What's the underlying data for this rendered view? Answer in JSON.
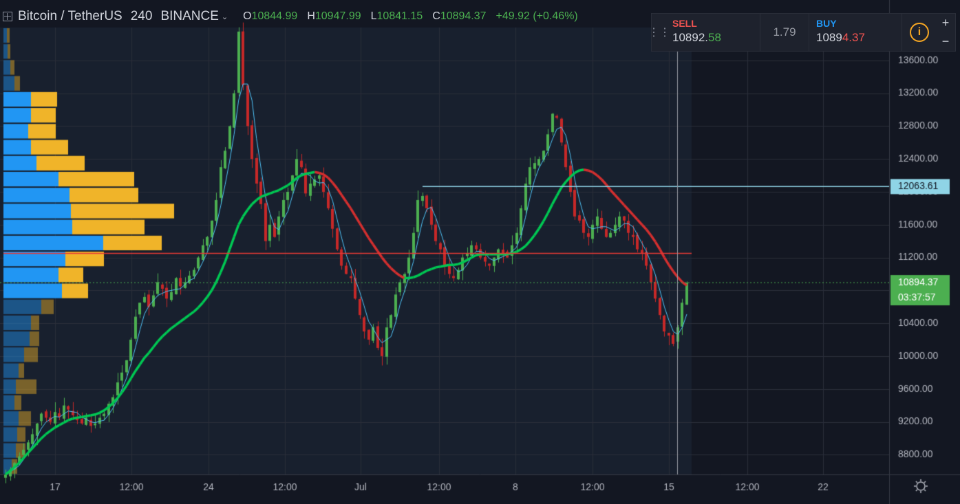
{
  "header": {
    "symbol": "Bitcoin / TetherUS",
    "interval": "240",
    "exchange": "BINANCE",
    "open_label": "O",
    "open": "10844.99",
    "high_label": "H",
    "high": "10947.99",
    "low_label": "L",
    "low": "10841.15",
    "close_label": "C",
    "close": "10894.37",
    "change": "+49.92 (+0.46%)"
  },
  "trade_panel": {
    "sell_label": "SELL",
    "sell_price_main": "10892.",
    "sell_price_tail": "58",
    "spread": "1.79",
    "buy_label": "BUY",
    "buy_price_main": "1089",
    "buy_price_tail": "4.37",
    "info_glyph": "i",
    "zoom_in": "+",
    "zoom_out": "−"
  },
  "colors": {
    "background": "#131722",
    "up_candle": "#4caf50",
    "down_candle": "#c62828",
    "ma_fast": "#00c853",
    "ma_slow": "#d32f2f",
    "short_ma": "#4fc3f7",
    "volume_profile_buy": "#2196f3",
    "volume_profile_sell": "#f0b429",
    "price_label_bg": "#4caf50",
    "horizontal_line_light": "#8fd4e6",
    "horizontal_line_red": "#e53935"
  },
  "chart_data": {
    "type": "candlestick",
    "y_axis_ticks": [
      "13600.00",
      "13200.00",
      "12800.00",
      "12400.00",
      "12000.00",
      "11600.00",
      "11200.00",
      "10800.00",
      "10400.00",
      "10000.00",
      "9600.00",
      "9200.00",
      "8800.00"
    ],
    "ylim": [
      8560,
      14000
    ],
    "x_axis_ticks": [
      "17",
      "12:00",
      "24",
      "12:00",
      "Jul",
      "12:00",
      "8",
      "12:00",
      "15",
      "12:00",
      "22"
    ],
    "current_price": "10894.37",
    "countdown": "03:37:57",
    "horizontal_level_label": "12063.61",
    "horizontal_level": 12063.61,
    "red_level": 11250,
    "close_series": [
      8560,
      8620,
      8700,
      8780,
      8860,
      8950,
      9050,
      9180,
      9300,
      9250,
      9200,
      9320,
      9260,
      9400,
      9350,
      9280,
      9220,
      9180,
      9250,
      9150,
      9180,
      9250,
      9300,
      9420,
      9500,
      9680,
      9800,
      9950,
      10200,
      10480,
      10650,
      10720,
      10600,
      10740,
      10900,
      10820,
      10700,
      10780,
      10950,
      10850,
      10900,
      10980,
      11050,
      11200,
      11350,
      11450,
      11650,
      11900,
      12300,
      12500,
      12800,
      13200,
      13950,
      13300,
      12800,
      12400,
      12100,
      11850,
      11400,
      11600,
      11450,
      11700,
      11900,
      12000,
      12200,
      12400,
      12300,
      11980,
      12100,
      12150,
      12200,
      12000,
      11800,
      11550,
      11300,
      11100,
      11000,
      10950,
      10700,
      10500,
      10300,
      10200,
      10350,
      10100,
      10000,
      10350,
      10500,
      10750,
      10900,
      11000,
      11200,
      11500,
      11900,
      11950,
      11800,
      11600,
      11400,
      11300,
      11100,
      11000,
      10950,
      11050,
      11200,
      11250,
      11350,
      11300,
      11200,
      11150,
      11100,
      11200,
      11300,
      11250,
      11200,
      11350,
      11500,
      11800,
      12100,
      12300,
      12350,
      12400,
      12500,
      12700,
      12950,
      12900,
      12600,
      12300,
      12000,
      11700,
      11650,
      11500,
      11450,
      11600,
      11700,
      11550,
      11450,
      11500,
      11600,
      11700,
      11650,
      11500,
      11450,
      11300,
      11250,
      11100,
      10900,
      10700,
      10500,
      10300,
      10250,
      10150,
      10350,
      10650,
      10894
    ],
    "ma_fast": [
      8560,
      8600,
      8650,
      8700,
      8760,
      8820,
      8880,
      8940,
      9000,
      9050,
      9090,
      9130,
      9160,
      9190,
      9220,
      9240,
      9250,
      9260,
      9270,
      9280,
      9290,
      9310,
      9340,
      9380,
      9430,
      9490,
      9560,
      9640,
      9730,
      9820,
      9900,
      9980,
      10040,
      10110,
      10180,
      10240,
      10290,
      10340,
      10380,
      10420,
      10460,
      10500,
      10540,
      10590,
      10650,
      10720,
      10800,
      10900,
      11020,
      11150,
      11300,
      11450,
      11600,
      11700,
      11780,
      11850,
      11900,
      11940,
      11960,
      11980,
      12000,
      12020,
      12050,
      12080,
      12120,
      12170,
      12200,
      12220,
      12230,
      12240,
      12230,
      12210,
      12170,
      12110,
      12040,
      11960,
      11880,
      11800,
      11710,
      11620,
      11530,
      11440,
      11360,
      11280,
      11200,
      11130,
      11070,
      11020,
      10980,
      10950,
      10950,
      10960,
      10980,
      11010,
      11040,
      11060,
      11080,
      11090,
      11100,
      11110,
      11110,
      11120,
      11140,
      11170,
      11200,
      11230,
      11240,
      11240,
      11240,
      11240,
      11240,
      11240,
      11240,
      11250,
      11270,
      11300,
      11340,
      11400,
      11470,
      11550,
      11640,
      11740,
      11850,
      11950,
      12050,
      12120,
      12180,
      12230,
      12260,
      12270,
      12260,
      12240,
      12200,
      12150,
      12090,
      12020,
      11960,
      11900,
      11840,
      11780,
      11720,
      11660,
      11600,
      11540,
      11470,
      11390,
      11300,
      11200,
      11110,
      11030,
      10960,
      10900,
      10860
    ],
    "ma_slow_line_note": ""
  },
  "volume_profile": {
    "buy_widths": [
      5,
      6,
      10,
      16,
      40,
      40,
      36,
      40,
      48,
      80,
      96,
      98,
      100,
      145,
      90,
      80,
      85,
      55,
      40,
      38,
      30,
      22,
      18,
      16,
      22,
      20,
      18,
      12
    ],
    "sell_widths": [
      4,
      4,
      6,
      8,
      38,
      36,
      40,
      54,
      70,
      110,
      100,
      150,
      105,
      85,
      56,
      36,
      38,
      18,
      12,
      14,
      20,
      8,
      30,
      10,
      18,
      12,
      14,
      8
    ]
  }
}
